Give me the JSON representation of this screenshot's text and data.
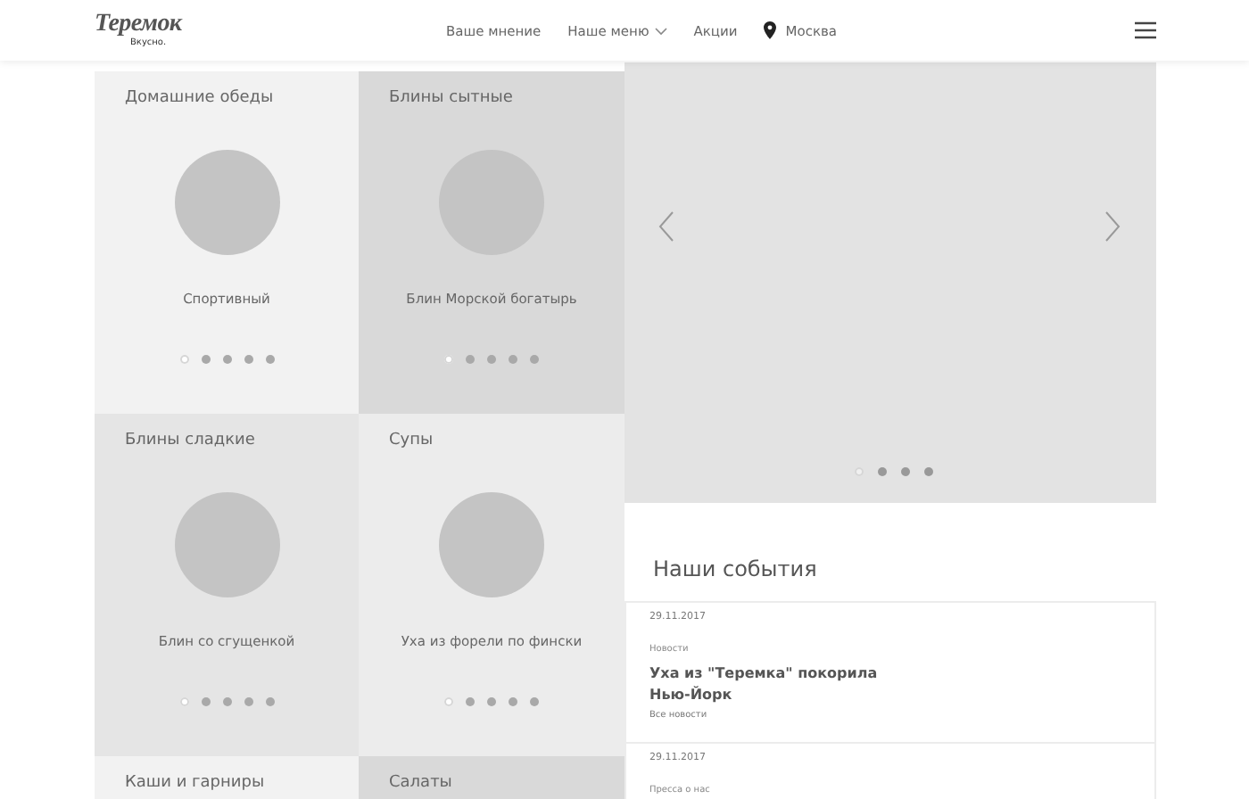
{
  "header": {
    "logo": "Теремок",
    "tagline": "Вкусно.",
    "nav": [
      {
        "label": "Ваше мнение",
        "dropdown": false
      },
      {
        "label": "Наше меню",
        "dropdown": true
      },
      {
        "label": "Акции",
        "dropdown": false
      }
    ],
    "location": "Москва"
  },
  "tiles": [
    {
      "title": "Домашние обеды",
      "dish": "Спортивный",
      "color": "#f2f2f2",
      "dots": [
        {
          "selected": true
        },
        {
          "selected": false
        },
        {
          "selected": false
        },
        {
          "selected": false
        },
        {
          "selected": false
        }
      ]
    },
    {
      "title": "Блины сытные",
      "dish": "Блин Морской богатырь",
      "color": "#d9d9d9",
      "dots": [
        {
          "selected": true
        },
        {
          "selected": false
        },
        {
          "selected": false
        },
        {
          "selected": false
        },
        {
          "selected": false
        }
      ]
    },
    {
      "title": "Блины сладкие",
      "dish": "Блин со сгущенкой",
      "color": "#e5e5e5",
      "dots": [
        {
          "selected": true
        },
        {
          "selected": false
        },
        {
          "selected": false
        },
        {
          "selected": false
        },
        {
          "selected": false
        }
      ]
    },
    {
      "title": "Супы",
      "dish": "Уха из форели по фински",
      "color": "#ececec",
      "dots": [
        {
          "selected": true
        },
        {
          "selected": false
        },
        {
          "selected": false
        },
        {
          "selected": false
        },
        {
          "selected": false
        }
      ]
    },
    {
      "title": "Каши и гарниры",
      "color": "#f2f2f2"
    },
    {
      "title": "Салаты",
      "color": "#d9d9d9"
    }
  ],
  "slider": {
    "dots": [
      {
        "selected": true
      },
      {
        "selected": false
      },
      {
        "selected": false
      },
      {
        "selected": false
      }
    ]
  },
  "events": {
    "title": "Наши события",
    "items": [
      {
        "date": "29.11.2017",
        "category": "Новости",
        "headline": "Уха из \"Теремка\" покорила Нью-Йорк",
        "link": "Все новости"
      },
      {
        "date": "29.11.2017",
        "category": "Пресса о нас"
      }
    ]
  }
}
